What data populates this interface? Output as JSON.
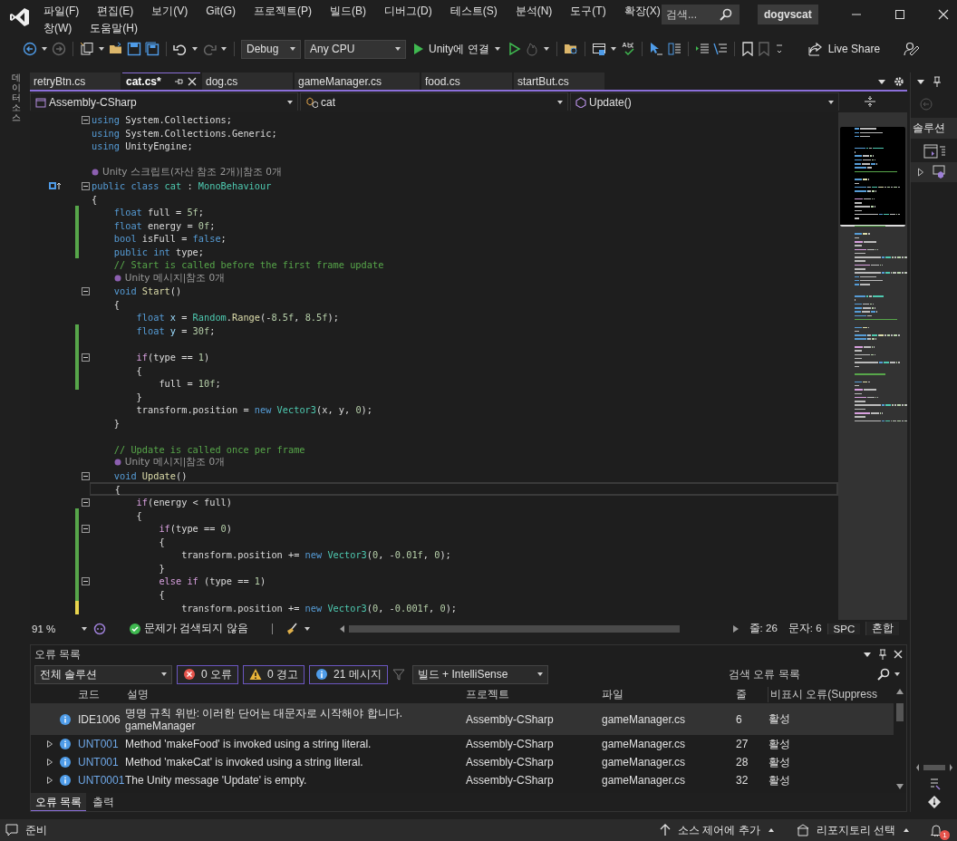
{
  "menu": {
    "rows": [
      [
        "파일(F)",
        "편집(E)",
        "보기(V)",
        "Git(G)",
        "프로젝트(P)",
        "빌드(B)",
        "디버그(D)",
        "테스트(S)",
        "분석(N)",
        "도구(T)",
        "확장(X)"
      ],
      [
        "창(W)",
        "도움말(H)"
      ]
    ]
  },
  "search": {
    "placeholder": "검색..."
  },
  "solution_name": "dogvscat",
  "toolbar": {
    "configuration": "Debug",
    "platform": "Any CPU",
    "run_target": "Unity에 연결",
    "live_share": "Live Share"
  },
  "side_tab": "데이터 소스",
  "tabs": [
    {
      "label": "retryBtn.cs",
      "selected": false
    },
    {
      "label": "cat.cs*",
      "selected": true
    },
    {
      "label": "dog.cs",
      "selected": false
    },
    {
      "label": "gameManager.cs",
      "selected": false
    },
    {
      "label": "food.cs",
      "selected": false
    },
    {
      "label": "startBut.cs",
      "selected": false
    }
  ],
  "nav": {
    "project": "Assembly-CSharp",
    "type": "cat",
    "member": "Update()"
  },
  "code": [
    {
      "kind": "code",
      "fold": true,
      "tokens": [
        {
          "text": "using",
          "kind": "kw"
        },
        {
          "text": " System.Collections;",
          "kind": "pl"
        }
      ]
    },
    {
      "kind": "code",
      "tokens": [
        {
          "text": "using",
          "kind": "kw"
        },
        {
          "text": " System.Collections.Generic;",
          "kind": "pl"
        }
      ]
    },
    {
      "kind": "code",
      "tokens": [
        {
          "text": "using",
          "kind": "kw"
        },
        {
          "text": " UnityEngine;",
          "kind": "pl"
        }
      ]
    },
    {
      "kind": "blank"
    },
    {
      "kind": "lens",
      "text": "Unity 스크립트(자산 참조 2개)|참조 0개"
    },
    {
      "kind": "code",
      "fold": true,
      "marker": true,
      "tokens": [
        {
          "text": "public class ",
          "kind": "kw"
        },
        {
          "text": "cat",
          "kind": "ty"
        },
        {
          "text": " : ",
          "kind": "pl"
        },
        {
          "text": "MonoBehaviour",
          "kind": "ty"
        }
      ]
    },
    {
      "kind": "code",
      "tokens": [
        {
          "text": "{",
          "kind": "pl"
        }
      ]
    },
    {
      "kind": "code",
      "changed": true,
      "tokens": [
        {
          "text": "    float",
          "kind": "kw"
        },
        {
          "text": " full = ",
          "kind": "pl"
        },
        {
          "text": "5f",
          "kind": "num"
        },
        {
          "text": ";",
          "kind": "pl"
        }
      ]
    },
    {
      "kind": "code",
      "changed": true,
      "tokens": [
        {
          "text": "    float",
          "kind": "kw"
        },
        {
          "text": " energy = ",
          "kind": "pl"
        },
        {
          "text": "0f",
          "kind": "num"
        },
        {
          "text": ";",
          "kind": "pl"
        }
      ]
    },
    {
      "kind": "code",
      "changed": true,
      "tokens": [
        {
          "text": "    bool",
          "kind": "kw"
        },
        {
          "text": " isFull = ",
          "kind": "pl"
        },
        {
          "text": "false",
          "kind": "kw"
        },
        {
          "text": ";",
          "kind": "pl"
        }
      ]
    },
    {
      "kind": "code",
      "changed": true,
      "tokens": [
        {
          "text": "    public int",
          "kind": "kw"
        },
        {
          "text": " type;",
          "kind": "pl"
        }
      ]
    },
    {
      "kind": "code",
      "tokens": [
        {
          "text": "    // Start is called before the first frame update",
          "kind": "cm"
        }
      ]
    },
    {
      "kind": "lens",
      "text": "Unity 메시지|참조 0개"
    },
    {
      "kind": "code",
      "fold": true,
      "tokens": [
        {
          "text": "    void ",
          "kind": "kw"
        },
        {
          "text": "Start",
          "kind": "fn"
        },
        {
          "text": "()",
          "kind": "pl"
        }
      ]
    },
    {
      "kind": "code",
      "tokens": [
        {
          "text": "    {",
          "kind": "pl"
        }
      ]
    },
    {
      "kind": "code",
      "tokens": [
        {
          "text": "        float ",
          "kind": "kw"
        },
        {
          "text": "x",
          "kind": "var"
        },
        {
          "text": " = ",
          "kind": "pl"
        },
        {
          "text": "Random",
          "kind": "ty"
        },
        {
          "text": ".",
          "kind": "pl"
        },
        {
          "text": "Range",
          "kind": "fn"
        },
        {
          "text": "(-",
          "kind": "pl"
        },
        {
          "text": "8.5f",
          "kind": "num"
        },
        {
          "text": ", ",
          "kind": "pl"
        },
        {
          "text": "8.5f",
          "kind": "num"
        },
        {
          "text": ");",
          "kind": "pl"
        }
      ]
    },
    {
      "kind": "code",
      "changed": true,
      "tokens": [
        {
          "text": "        float ",
          "kind": "kw"
        },
        {
          "text": "y",
          "kind": "var"
        },
        {
          "text": " = ",
          "kind": "pl"
        },
        {
          "text": "30f",
          "kind": "num"
        },
        {
          "text": ";",
          "kind": "pl"
        }
      ]
    },
    {
      "kind": "blank",
      "changed": true
    },
    {
      "kind": "code",
      "fold": true,
      "changed": true,
      "tokens": [
        {
          "text": "        if",
          "kind": "ctl"
        },
        {
          "text": "(type == ",
          "kind": "pl"
        },
        {
          "text": "1",
          "kind": "num"
        },
        {
          "text": ")",
          "kind": "pl"
        }
      ]
    },
    {
      "kind": "code",
      "changed": true,
      "tokens": [
        {
          "text": "        {",
          "kind": "pl"
        }
      ]
    },
    {
      "kind": "code",
      "changed": true,
      "tokens": [
        {
          "text": "            full = ",
          "kind": "pl"
        },
        {
          "text": "10f",
          "kind": "num"
        },
        {
          "text": ";",
          "kind": "pl"
        }
      ]
    },
    {
      "kind": "code",
      "tokens": [
        {
          "text": "        }",
          "kind": "pl"
        }
      ]
    },
    {
      "kind": "code",
      "tokens": [
        {
          "text": "        transform.position = ",
          "kind": "pl"
        },
        {
          "text": "new ",
          "kind": "kw"
        },
        {
          "text": "Vector3",
          "kind": "ty"
        },
        {
          "text": "(x, y, ",
          "kind": "pl"
        },
        {
          "text": "0",
          "kind": "num"
        },
        {
          "text": ");",
          "kind": "pl"
        }
      ]
    },
    {
      "kind": "code",
      "tokens": [
        {
          "text": "    }",
          "kind": "pl"
        }
      ]
    },
    {
      "kind": "blank"
    },
    {
      "kind": "code",
      "tokens": [
        {
          "text": "    // Update is called once per frame",
          "kind": "cm"
        }
      ]
    },
    {
      "kind": "lens",
      "text": "Unity 메시지|참조 0개"
    },
    {
      "kind": "code",
      "fold": true,
      "tokens": [
        {
          "text": "    void ",
          "kind": "kw"
        },
        {
          "text": "Update",
          "kind": "fn"
        },
        {
          "text": "()",
          "kind": "pl"
        }
      ]
    },
    {
      "kind": "code",
      "current": true,
      "tokens": [
        {
          "text": "    {",
          "kind": "pl"
        }
      ]
    },
    {
      "kind": "code",
      "fold": true,
      "tokens": [
        {
          "text": "        if",
          "kind": "ctl"
        },
        {
          "text": "(energy < full)",
          "kind": "pl"
        }
      ]
    },
    {
      "kind": "code",
      "changed": true,
      "tokens": [
        {
          "text": "        {",
          "kind": "pl"
        }
      ]
    },
    {
      "kind": "code",
      "fold": true,
      "changed": true,
      "tokens": [
        {
          "text": "            if",
          "kind": "ctl"
        },
        {
          "text": "(type == ",
          "kind": "pl"
        },
        {
          "text": "0",
          "kind": "num"
        },
        {
          "text": ")",
          "kind": "pl"
        }
      ]
    },
    {
      "kind": "code",
      "changed": true,
      "tokens": [
        {
          "text": "            {",
          "kind": "pl"
        }
      ]
    },
    {
      "kind": "code",
      "changed": true,
      "tokens": [
        {
          "text": "                transform.position += ",
          "kind": "pl"
        },
        {
          "text": "new ",
          "kind": "kw"
        },
        {
          "text": "Vector3",
          "kind": "ty"
        },
        {
          "text": "(",
          "kind": "pl"
        },
        {
          "text": "0",
          "kind": "num"
        },
        {
          "text": ", -",
          "kind": "pl"
        },
        {
          "text": "0.01f",
          "kind": "num"
        },
        {
          "text": ", ",
          "kind": "pl"
        },
        {
          "text": "0",
          "kind": "num"
        },
        {
          "text": ");",
          "kind": "pl"
        }
      ]
    },
    {
      "kind": "code",
      "changed": true,
      "tokens": [
        {
          "text": "            }",
          "kind": "pl"
        }
      ]
    },
    {
      "kind": "code",
      "fold": true,
      "changed": true,
      "tokens": [
        {
          "text": "            else if",
          "kind": "ctl"
        },
        {
          "text": " (type == ",
          "kind": "pl"
        },
        {
          "text": "1",
          "kind": "num"
        },
        {
          "text": ")",
          "kind": "pl"
        }
      ]
    },
    {
      "kind": "code",
      "changed": true,
      "tokens": [
        {
          "text": "            {",
          "kind": "pl"
        }
      ]
    },
    {
      "kind": "code",
      "changed": true,
      "unsaved": true,
      "tokens": [
        {
          "text": "                transform.position += ",
          "kind": "pl"
        },
        {
          "text": "new ",
          "kind": "kw"
        },
        {
          "text": "Vector3",
          "kind": "ty"
        },
        {
          "text": "(",
          "kind": "pl"
        },
        {
          "text": "0",
          "kind": "num"
        },
        {
          "text": ", -",
          "kind": "pl"
        },
        {
          "text": "0.001f",
          "kind": "num"
        },
        {
          "text": ", ",
          "kind": "pl"
        },
        {
          "text": "0",
          "kind": "num"
        },
        {
          "text": ");",
          "kind": "pl"
        }
      ]
    }
  ],
  "editor_status": {
    "zoom": "91 %",
    "issues": "문제가 검색되지 않음",
    "line": "줄: 26",
    "column": "문자: 6",
    "whitespace": "SPC",
    "line_endings": "혼합"
  },
  "right_panel": {
    "tab": "솔루션"
  },
  "error_list": {
    "title": "오류 목록",
    "scope": "전체 솔루션",
    "filters": [
      {
        "kind": "error",
        "label": "0 오류",
        "selected": true
      },
      {
        "kind": "warning",
        "label": "0 경고",
        "selected": true
      },
      {
        "kind": "info",
        "label": "21 메시지",
        "selected": true
      }
    ],
    "source": "빌드 + IntelliSense",
    "search_placeholder": "검색 오류 목록",
    "columns": [
      "코드",
      "설명",
      "프로젝트",
      "파일",
      "줄",
      "비표시 오류(Suppress"
    ],
    "rows": [
      {
        "code": "IDE1006",
        "description": "명명 규칙 위반: 이러한 단어는 대문자로 시작해야 합니다.\ngameManager",
        "project": "Assembly-CSharp",
        "file": "gameManager.cs",
        "line": "6",
        "state": "활성",
        "expandable": false,
        "selected": true
      },
      {
        "code": "UNT001",
        "description": "Method 'makeFood' is invoked using a string literal.",
        "project": "Assembly-CSharp",
        "file": "gameManager.cs",
        "line": "27",
        "state": "활성",
        "expandable": true,
        "selected": false
      },
      {
        "code": "UNT001",
        "description": "Method 'makeCat' is invoked using a string literal.",
        "project": "Assembly-CSharp",
        "file": "gameManager.cs",
        "line": "28",
        "state": "활성",
        "expandable": true,
        "selected": false
      },
      {
        "code": "UNT0001",
        "description": "The Unity message 'Update' is empty.",
        "project": "Assembly-CSharp",
        "file": "gameManager.cs",
        "line": "32",
        "state": "활성",
        "expandable": true,
        "selected": false
      }
    ],
    "bottom_tabs": [
      {
        "label": "오류 목록",
        "selected": true
      },
      {
        "label": "출력",
        "selected": false
      }
    ]
  },
  "status_bar": {
    "text": "준비",
    "source_control": "소스 제어에 추가",
    "repository": "리포지토리 선택",
    "notifications": "1"
  }
}
